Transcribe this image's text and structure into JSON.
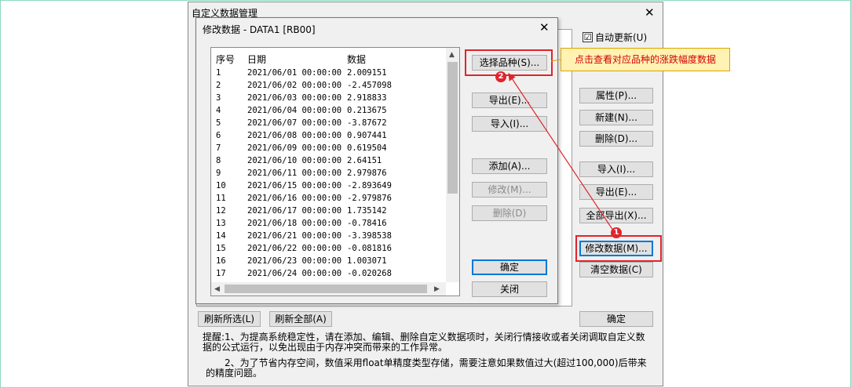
{
  "outer_dialog": {
    "title": "自定义数据管理",
    "auto_update_label": "自动更新(U)",
    "auto_update_checked": "☑",
    "buttons": {
      "properties": "属性(P)...",
      "new": "新建(N)...",
      "delete": "删除(D)...",
      "import": "导入(I)...",
      "export": "导出(E)...",
      "export_all": "全部导出(X)...",
      "modify_data": "修改数据(M)...",
      "clear_data": "清空数据(C)",
      "refresh_selected": "刷新所选(L)",
      "refresh_all": "刷新全部(A)",
      "ok": "确定"
    },
    "note_line1": "提醒:1、为提高系统稳定性，请在添加、编辑、删除自定义数据项时，关闭行情接收或者关闭调取自定义数",
    "note_line2": "据的公式运行，以免出现由于内存冲突而带来的工作异常。",
    "note_line3": "2、为了节省内存空间，数值采用float单精度类型存储，需要注意如果数值过大(超过100,000)后带来",
    "note_line4": "的精度问题。"
  },
  "inner_dialog": {
    "title": "修改数据 - DATA1 [RB00]",
    "columns": [
      "序号",
      "日期",
      "数据"
    ],
    "rows": [
      [
        "1",
        "2021/06/01 00:00:00",
        "2.009151"
      ],
      [
        "2",
        "2021/06/02 00:00:00",
        "-2.457098"
      ],
      [
        "3",
        "2021/06/03 00:00:00",
        "2.918833"
      ],
      [
        "4",
        "2021/06/04 00:00:00",
        "0.213675"
      ],
      [
        "5",
        "2021/06/07 00:00:00",
        "-3.87672"
      ],
      [
        "6",
        "2021/06/08 00:00:00",
        "0.907441"
      ],
      [
        "7",
        "2021/06/09 00:00:00",
        "0.619504"
      ],
      [
        "8",
        "2021/06/10 00:00:00",
        "2.64151"
      ],
      [
        "9",
        "2021/06/11 00:00:00",
        "2.979876"
      ],
      [
        "10",
        "2021/06/15 00:00:00",
        "-2.893649"
      ],
      [
        "11",
        "2021/06/16 00:00:00",
        "-2.979876"
      ],
      [
        "12",
        "2021/06/17 00:00:00",
        "1.735142"
      ],
      [
        "13",
        "2021/06/18 00:00:00",
        "-0.78416"
      ],
      [
        "14",
        "2021/06/21 00:00:00",
        "-3.398538"
      ],
      [
        "15",
        "2021/06/22 00:00:00",
        "-0.081816"
      ],
      [
        "16",
        "2021/06/23 00:00:00",
        "1.003071"
      ],
      [
        "17",
        "2021/06/24 00:00:00",
        "-0.020268"
      ]
    ],
    "buttons": {
      "select_variety": "选择品种(S)...",
      "export": "导出(E)...",
      "import": "导入(I)...",
      "add": "添加(A)...",
      "modify": "修改(M)...",
      "delete": "删除(D)",
      "ok": "确定",
      "close": "关闭"
    }
  },
  "annotations": {
    "callout_text": "点击查看对应品种的涨跌幅度数据",
    "badge1": "1",
    "badge2": "2",
    "accent_color": "#e0242b"
  },
  "icons": {
    "close": "close-icon",
    "scroll_up": "scroll-up-icon",
    "scroll_down": "scroll-down-icon",
    "scroll_left": "scroll-left-icon",
    "scroll_right": "scroll-right-icon"
  }
}
